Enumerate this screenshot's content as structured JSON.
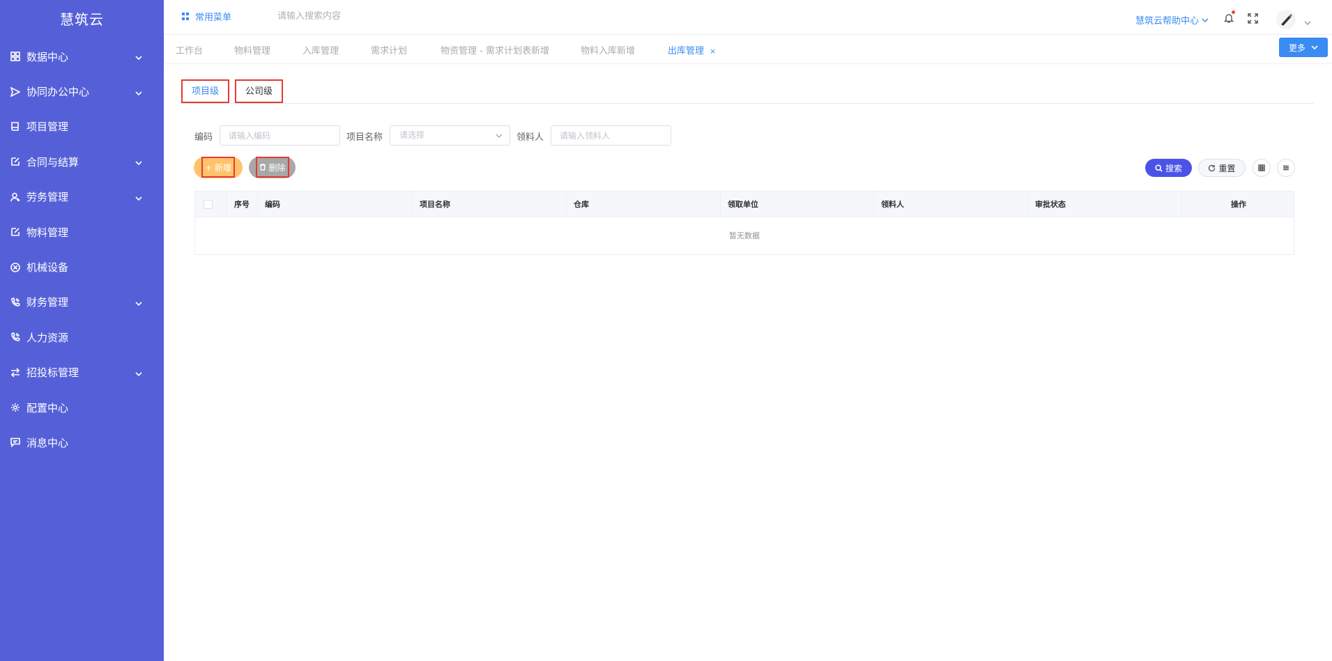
{
  "brand": {
    "name": "慧筑云",
    "sidebar_color": "#5560d8",
    "accent": "#3a8bf2"
  },
  "sidebar": {
    "items": [
      {
        "label": "数据中心",
        "icon": "grid-icon",
        "expandable": true
      },
      {
        "label": "协同办公中心",
        "icon": "send-icon",
        "expandable": true
      },
      {
        "label": "项目管理",
        "icon": "book-icon",
        "expandable": false
      },
      {
        "label": "合同与结算",
        "icon": "edit-icon",
        "expandable": true
      },
      {
        "label": "劳务管理",
        "icon": "user-icon",
        "expandable": true
      },
      {
        "label": "物料管理",
        "icon": "edit-icon",
        "expandable": false
      },
      {
        "label": "机械设备",
        "icon": "circle-x-icon",
        "expandable": false
      },
      {
        "label": "财务管理",
        "icon": "phone-icon",
        "expandable": true
      },
      {
        "label": "人力资源",
        "icon": "phone-icon",
        "expandable": false
      },
      {
        "label": "招投标管理",
        "icon": "transfer-icon",
        "expandable": true
      },
      {
        "label": "配置中心",
        "icon": "gear-icon",
        "expandable": false
      },
      {
        "label": "消息中心",
        "icon": "message-icon",
        "expandable": false
      }
    ]
  },
  "header": {
    "common_menu": "常用菜单",
    "search_placeholder": "请输入搜索内容",
    "help": "慧筑云帮助中心"
  },
  "tabs": {
    "items": [
      "工作台",
      "物料管理",
      "入库管理",
      "需求计划",
      "物资管理 - 需求计划表新增",
      "物料入库新增",
      "出库管理"
    ],
    "active": "出库管理",
    "close": "×",
    "more": "更多"
  },
  "level_tabs": {
    "project": "项目级",
    "company": "公司级"
  },
  "filters": {
    "code_label": "编码",
    "code_placeholder": "请输入编码",
    "project_label": "项目名称",
    "project_placeholder": "请选择",
    "receiver_label": "领料人",
    "receiver_placeholder": "请输入领料人"
  },
  "actions": {
    "add": "+ 新增",
    "delete": "删除",
    "search": "搜索",
    "reset": "重置"
  },
  "table": {
    "columns": [
      "序号",
      "编码",
      "项目名称",
      "仓库",
      "领取单位",
      "领料人",
      "审批状态",
      "操作"
    ],
    "empty": "暂无数据"
  }
}
